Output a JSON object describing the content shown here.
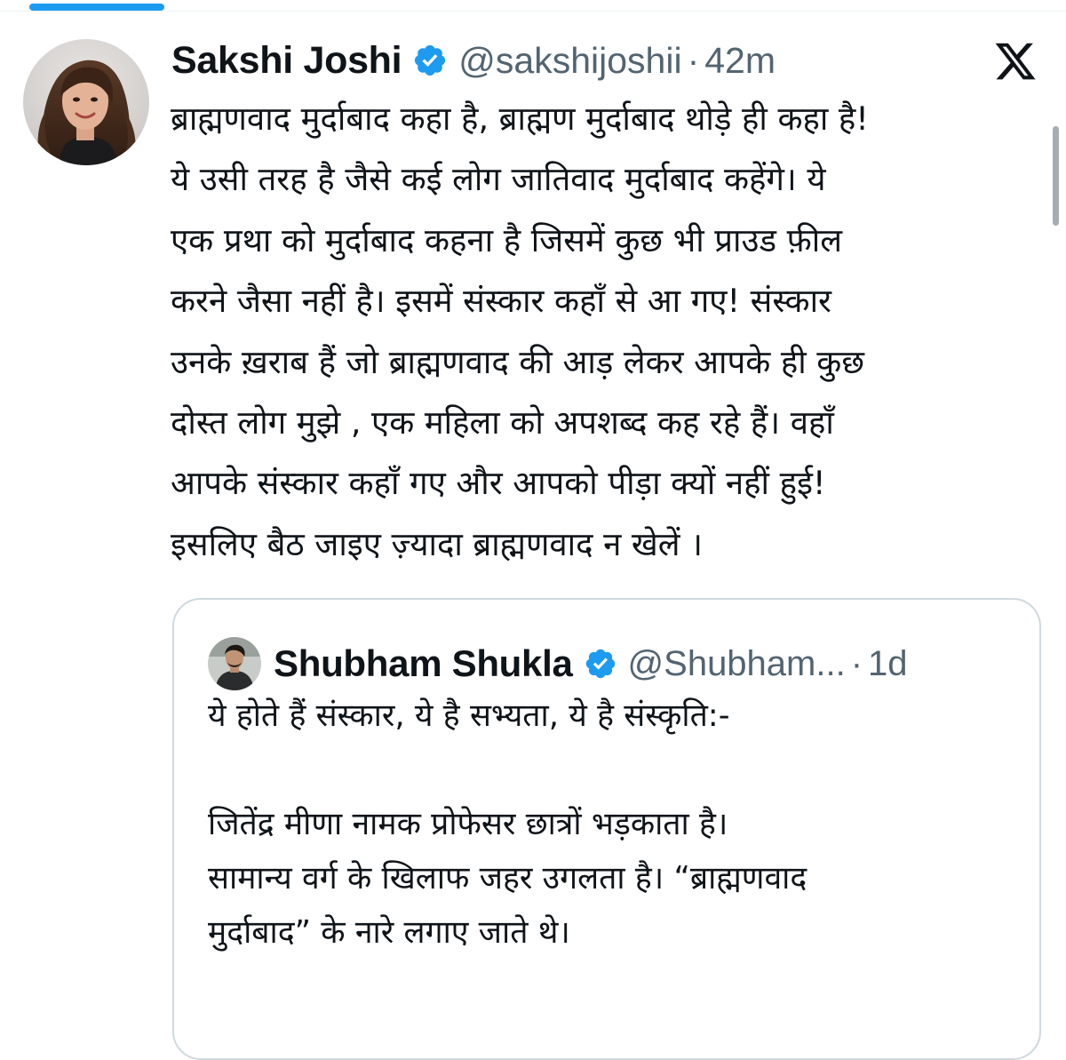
{
  "tweet": {
    "author": {
      "display_name": "Sakshi Joshi",
      "handle": "@sakshijoshii",
      "verified": true
    },
    "separator": "·",
    "time": "42m",
    "platform_icon": "x-logo-icon",
    "text_lines": [
      "ब्राह्मणवाद मुर्दाबाद कहा है, ब्राह्मण मुर्दाबाद थोड़े ही कहा है!",
      "ये उसी तरह है जैसे कई लोग जातिवाद मुर्दाबाद कहेंगे। ये",
      "एक प्रथा को मुर्दाबाद कहना है जिसमें कुछ भी प्राउड फ़ील",
      "करने जैसा नहीं है। इसमें संस्कार कहाँ से आ गए! संस्कार",
      "उनके ख़राब हैं जो ब्राह्मणवाद की आड़ लेकर आपके ही कुछ",
      "दोस्त लोग मुझे , एक महिला को अपशब्द कह रहे हैं। वहाँ",
      "आपके संस्कार कहाँ गए और आपको पीड़ा क्यों नहीं हुई!",
      "इसलिए बैठ जाइए ज़्यादा ब्राह्मणवाद न खेलें ।"
    ]
  },
  "quoted_tweet": {
    "author": {
      "display_name": "Shubham Shukla",
      "handle": "@Shubham...",
      "verified": true
    },
    "separator": "·",
    "time": "1d",
    "text_lines": [
      "ये होते हैं संस्कार, ये है सभ्यता, ये है संस्कृति:-",
      "",
      "जितेंद्र मीणा नामक प्रोफेसर छात्रों भड़काता है।",
      "सामान्य वर्ग के खिलाफ जहर उगलता है। “ब्राह्मणवाद",
      "मुर्दाबाद” के नारे लगाए जाते थे।"
    ]
  },
  "colors": {
    "accent": "#1d9bf0",
    "text_primary": "#0f1419",
    "text_secondary": "#536471",
    "border": "#cfd9de",
    "background": "#ffffff"
  }
}
